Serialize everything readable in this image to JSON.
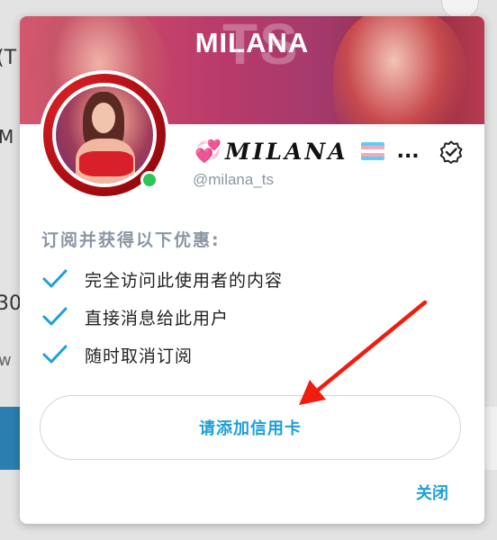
{
  "background": {
    "fragments": [
      "(T",
      "M",
      "30",
      "w"
    ]
  },
  "banner": {
    "title": "MILANA",
    "watermark": "TS"
  },
  "profile": {
    "emoji_icon": "two-hearts-icon",
    "name": "MILANA",
    "flag_icon": "transgender-flag-icon",
    "ellipsis": "...",
    "verified_icon": "verified-badge-icon",
    "handle": "@milana_ts",
    "online": true
  },
  "benefits": {
    "title": "订阅并获得以下优惠:",
    "items": [
      {
        "text": "完全访问此使用者的内容"
      },
      {
        "text": "直接消息给此用户"
      },
      {
        "text": "随时取消订阅"
      }
    ]
  },
  "actions": {
    "add_card_label": "请添加信用卡",
    "close_label": "关闭"
  },
  "colors": {
    "accent": "#1d9fd8",
    "online": "#2bc558",
    "arrow": "#f01c0e",
    "muted": "#8a96a3"
  }
}
